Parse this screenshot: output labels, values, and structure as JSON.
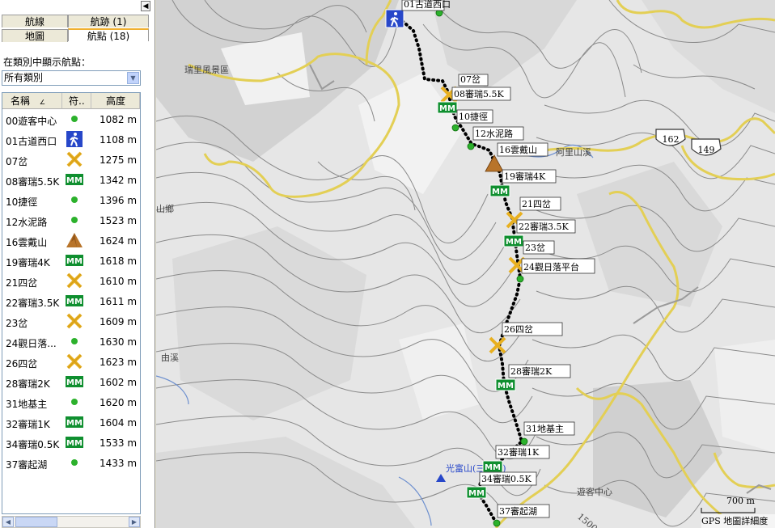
{
  "tabs": {
    "row1": [
      {
        "label": "航線"
      },
      {
        "label": "航跡 (1)"
      }
    ],
    "row2": [
      {
        "label": "地圖"
      },
      {
        "label": "航點 (18)"
      }
    ]
  },
  "category_label": "在類別中顯示航點：",
  "category_select": {
    "value": "所有類別"
  },
  "columns": {
    "name": "名稱",
    "symbol": "符..",
    "elevation": "高度"
  },
  "waypoints": [
    {
      "name": "00遊客中心",
      "icon": "green-dot-icon",
      "elevation": "1082 m"
    },
    {
      "name": "01古道西口",
      "icon": "hiker-icon",
      "elevation": "1108 m"
    },
    {
      "name": "07岔",
      "icon": "crossing-icon",
      "elevation": "1275 m"
    },
    {
      "name": "08審瑞5.5K",
      "icon": "milemarker-icon",
      "elevation": "1342 m"
    },
    {
      "name": "10捷徑",
      "icon": "green-dot-icon",
      "elevation": "1396 m"
    },
    {
      "name": "12水泥路",
      "icon": "green-dot-icon",
      "elevation": "1523 m"
    },
    {
      "name": "16雲戴山",
      "icon": "summit-icon",
      "elevation": "1624 m"
    },
    {
      "name": "19審瑞4K",
      "icon": "milemarker-icon",
      "elevation": "1618 m"
    },
    {
      "name": "21四岔",
      "icon": "crossing-icon",
      "elevation": "1610 m"
    },
    {
      "name": "22審瑞3.5K",
      "icon": "milemarker-icon",
      "elevation": "1611 m"
    },
    {
      "name": "23岔",
      "icon": "crossing-icon",
      "elevation": "1609 m"
    },
    {
      "name": "24觀日落...",
      "icon": "green-dot-icon",
      "elevation": "1630 m"
    },
    {
      "name": "26四岔",
      "icon": "crossing-icon",
      "elevation": "1623 m"
    },
    {
      "name": "28審瑞2K",
      "icon": "milemarker-icon",
      "elevation": "1602 m"
    },
    {
      "name": "31地基主",
      "icon": "green-dot-icon",
      "elevation": "1620 m"
    },
    {
      "name": "32審瑞1K",
      "icon": "milemarker-icon",
      "elevation": "1604 m"
    },
    {
      "name": "34審瑞0.5K",
      "icon": "milemarker-icon",
      "elevation": "1533 m"
    },
    {
      "name": "37審起湖",
      "icon": "green-dot-icon",
      "elevation": "1433 m"
    }
  ],
  "map": {
    "waypoint_labels": [
      "01古道西口",
      "07岔",
      "08審瑞5.5K",
      "10捷徑",
      "12水泥路",
      "16雲戴山",
      "19審瑞4K",
      "21四岔",
      "22審瑞3.5K",
      "23岔",
      "24觀日落平台",
      "26四岔",
      "28審瑞2K",
      "31地基主",
      "32審瑞1K",
      "34審瑞0.5K",
      "37審起湖"
    ],
    "place_labels": [
      "瑞里風景區",
      "阿里山溪",
      "山鄉",
      "由溪",
      "光富山(三角點)",
      "遊客中心"
    ],
    "road_shields": [
      "162",
      "149"
    ],
    "contour_label": "1500",
    "scale_label": "700 m",
    "status_label": "GPS 地圖詳細度"
  },
  "colors": {
    "road": "#e3cf55",
    "contour": "#8a8a8a",
    "river": "#6c8fcf",
    "waypoint_dot": "#2cb12c",
    "milemarker": "#0f8f2f",
    "crossing": "#e8b020",
    "hiker": "#2747c9"
  }
}
